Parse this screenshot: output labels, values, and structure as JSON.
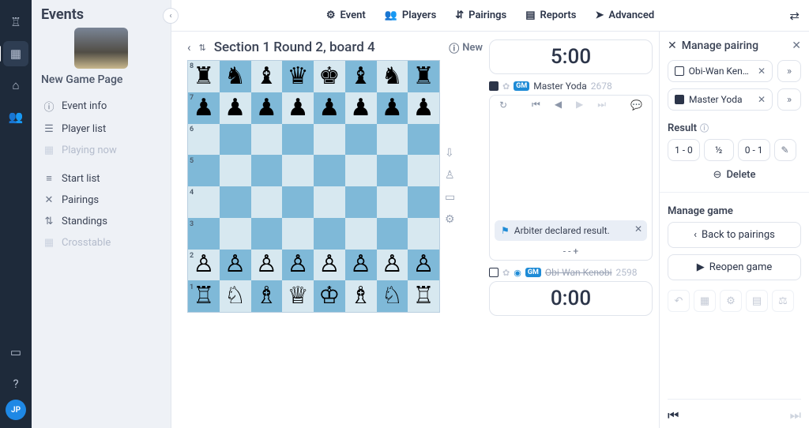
{
  "rail": {
    "avatar_initials": "JP"
  },
  "events": {
    "header": "Events",
    "page_name": "New Game Page",
    "items": {
      "event_info": "Event info",
      "player_list": "Player list",
      "playing_now": "Playing now",
      "start_list": "Start list",
      "pairings": "Pairings",
      "standings": "Standings",
      "crosstable": "Crosstable"
    }
  },
  "topnav": {
    "event": "Event",
    "players": "Players",
    "pairings": "Pairings",
    "reports": "Reports",
    "advanced": "Advanced"
  },
  "crumb": {
    "title": "Section 1 Round 2, board 4",
    "new_label": "New"
  },
  "board": {
    "ranks": [
      "8",
      "7",
      "6",
      "5",
      "4",
      "3",
      "2",
      "1"
    ],
    "position": [
      [
        "r",
        "n",
        "b",
        "q",
        "k",
        "b",
        "n",
        "r"
      ],
      [
        "p",
        "p",
        "p",
        "p",
        "p",
        "p",
        "p",
        "p"
      ],
      [
        "",
        "",
        "",
        "",
        "",
        "",
        "",
        ""
      ],
      [
        "",
        "",
        "",
        "",
        "",
        "",
        "",
        ""
      ],
      [
        "",
        "",
        "",
        "",
        "",
        "",
        "",
        ""
      ],
      [
        "",
        "",
        "",
        "",
        "",
        "",
        "",
        ""
      ],
      [
        "P",
        "P",
        "P",
        "P",
        "P",
        "P",
        "P",
        "P"
      ],
      [
        "R",
        "N",
        "B",
        "Q",
        "K",
        "B",
        "N",
        "R"
      ]
    ]
  },
  "game": {
    "top_clock": "5:00",
    "bottom_clock": "0:00",
    "black": {
      "name": "Master Yoda",
      "rating": "2678",
      "title": "GM"
    },
    "white": {
      "name": "Obi-Wan Kenobi",
      "rating": "2598",
      "title": "GM"
    },
    "arbiter_msg": "Arbiter declared result.",
    "score_line": "- -  +"
  },
  "panel": {
    "title": "Manage pairing",
    "white_chip": "Obi-Wan Kenobi",
    "black_chip": "Master Yoda",
    "result_label": "Result",
    "results": {
      "w": "1 - 0",
      "d": "½",
      "b": "0 - 1"
    },
    "delete": "Delete",
    "manage_game": "Manage game",
    "back": "Back to pairings",
    "reopen": "Reopen game"
  }
}
